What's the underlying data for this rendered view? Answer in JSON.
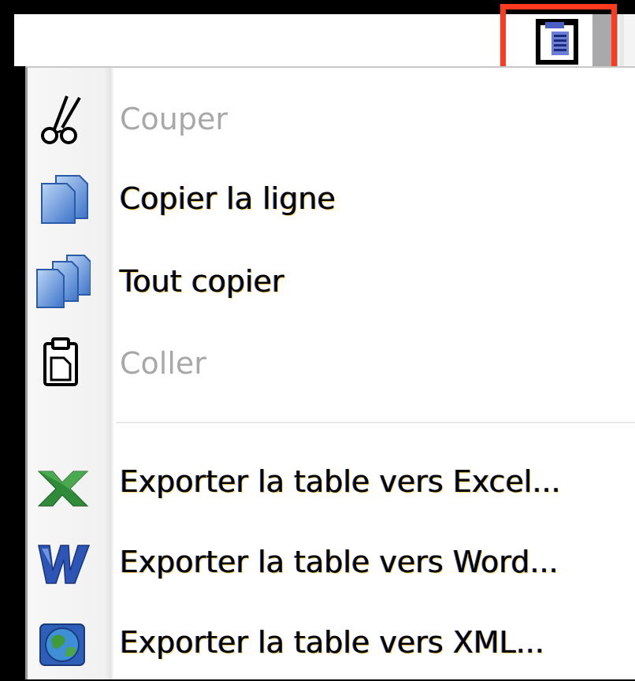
{
  "toolbar": {
    "button_icon": "clipboard-list-icon",
    "highlight_color": "#ff3b1f"
  },
  "menu": {
    "items": [
      {
        "label": "Couper",
        "icon": "scissors-icon",
        "enabled": false
      },
      {
        "label": "Copier la ligne",
        "icon": "copy-icon",
        "enabled": true
      },
      {
        "label": "Tout copier",
        "icon": "copy-all-icon",
        "enabled": true
      },
      {
        "label": "Coller",
        "icon": "paste-icon",
        "enabled": false
      },
      {
        "label": "Exporter la table vers Excel...",
        "icon": "excel-icon",
        "enabled": true
      },
      {
        "label": "Exporter la table vers Word...",
        "icon": "word-icon",
        "enabled": true
      },
      {
        "label": "Exporter la table vers XML...",
        "icon": "xml-globe-icon",
        "enabled": true
      }
    ]
  },
  "colors": {
    "disabled_text": "#a8a8a8",
    "enabled_text": "#000000",
    "gutter": "#f1f1f1"
  }
}
